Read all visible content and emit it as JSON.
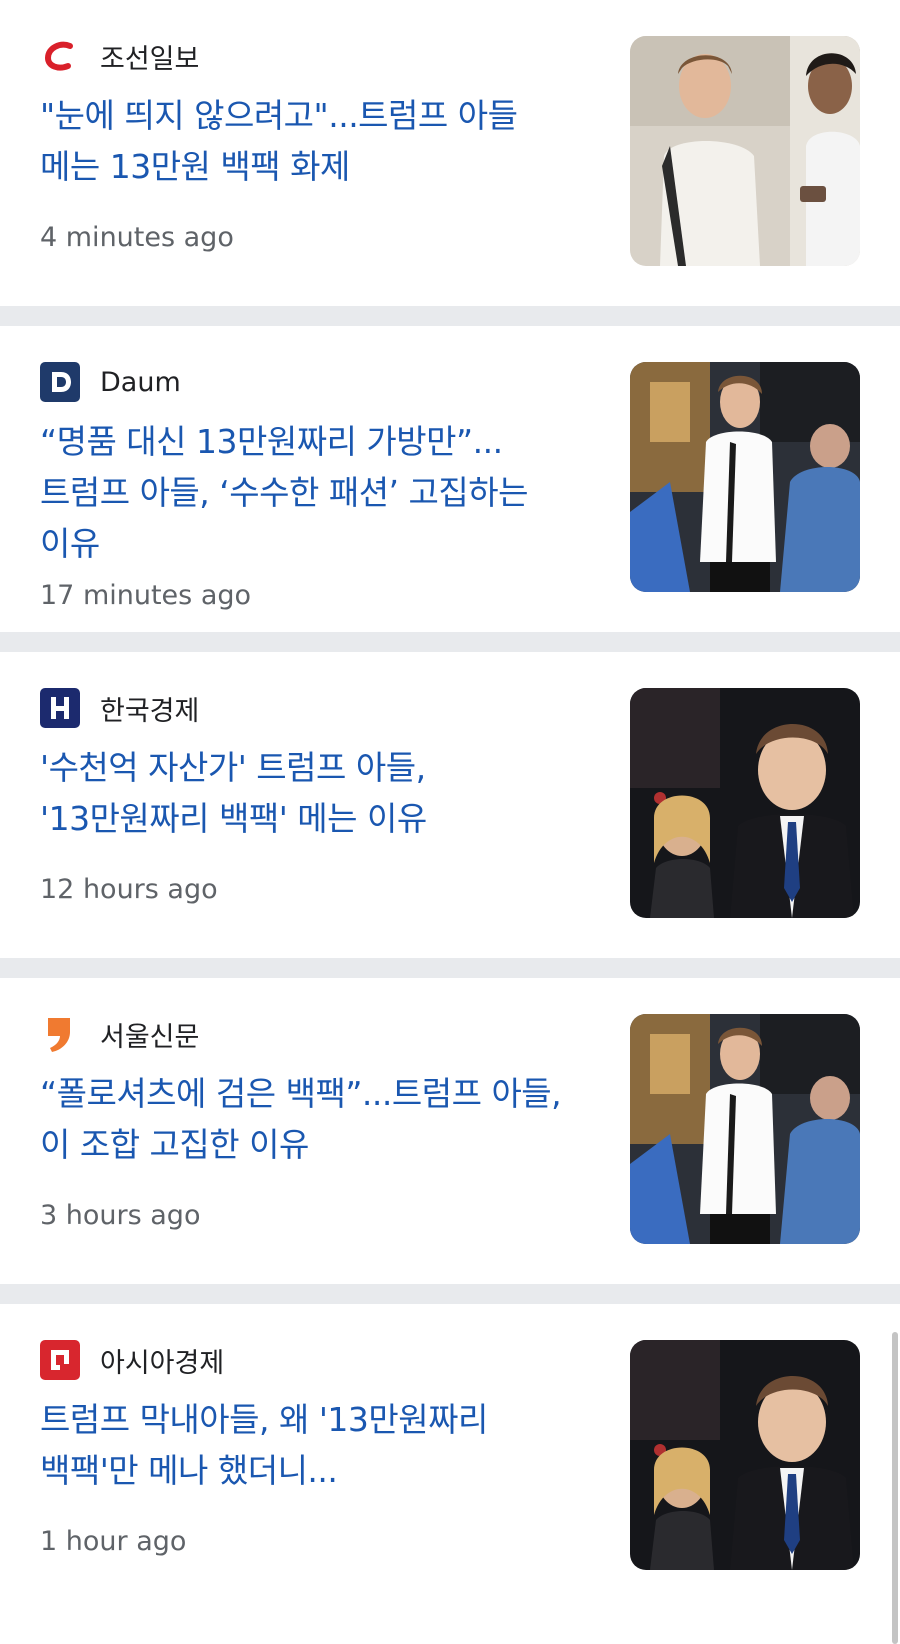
{
  "articles": [
    {
      "source": "조선일보",
      "logo_icon": "chosun-swoosh-icon",
      "headline": "\"눈에 띄지 않으려고\"...트럼프 아들 메는 13만원 백팩 화제",
      "time": "4 minutes ago",
      "thumbnail": "young-man-with-backpack-photo"
    },
    {
      "source": "Daum",
      "logo_icon": "daum-d-icon",
      "headline": "“명품 대신 13만원짜리 가방만”...트럼프 아들, ‘수수한 패션’ 고집하는 이유",
      "time": "17 minutes ago",
      "thumbnail": "young-man-white-shirt-photo"
    },
    {
      "source": "한국경제",
      "logo_icon": "hankyung-h-icon",
      "headline": "'수천억 자산가' 트럼프 아들, '13만원짜리 백팩' 메는 이유",
      "time": "12 hours ago",
      "thumbnail": "young-man-suit-photo"
    },
    {
      "source": "서울신문",
      "logo_icon": "seoul-comma-icon",
      "headline": "“폴로셔츠에 검은 백팩”...트럼프 아들, 이 조합 고집한 이유",
      "time": "3 hours ago",
      "thumbnail": "young-man-white-shirt-photo"
    },
    {
      "source": "아시아경제",
      "logo_icon": "asiae-square-icon",
      "headline": "트럼프 막내아들, 왜 '13만원짜리 백팩'만 메나 했더니...",
      "time": "1 hour ago",
      "thumbnail": "young-man-suit-photo"
    }
  ],
  "colors": {
    "headline": "#1a57b0",
    "divider": "#e8eaed",
    "time": "#5f6368"
  }
}
